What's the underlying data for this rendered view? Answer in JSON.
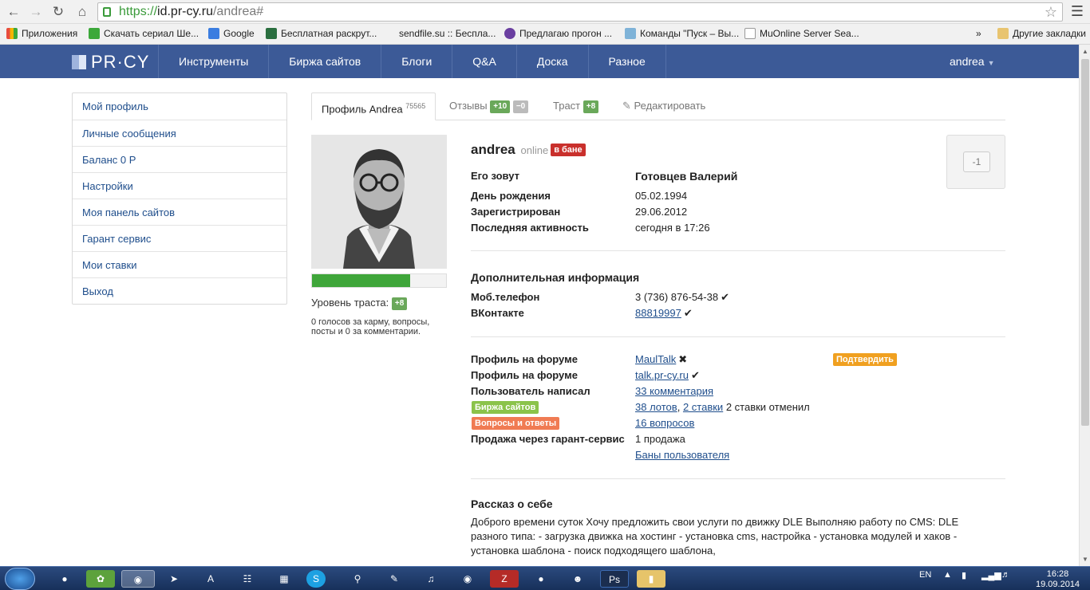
{
  "browser": {
    "url_scheme": "https://",
    "url_domain": "id.pr-cy.ru",
    "url_path": "/andrea#"
  },
  "bookmarks": {
    "items": [
      {
        "label": "Приложения",
        "color": "#e84c3d"
      },
      {
        "label": "Скачать сериал Ше...",
        "color": "#3ca83a"
      },
      {
        "label": "Google",
        "color": "#3b7de0"
      },
      {
        "label": "Бесплатная раскрут...",
        "color": "#2a6e3f"
      },
      {
        "label": "sendfile.su :: Беспла...",
        "color": "#ffffff"
      },
      {
        "label": "Предлагаю прогон ...",
        "color": "#6a3fa0"
      },
      {
        "label": "Команды \"Пуск – Вы...",
        "color": "#7fb3d8"
      },
      {
        "label": "MuOnline Server Sea...",
        "color": "#e6e6e6"
      }
    ],
    "more": "»",
    "other": "Другие закладки"
  },
  "site": {
    "logo": "PR·CY",
    "nav": [
      "Инструменты",
      "Биржа сайтов",
      "Блоги",
      "Q&A",
      "Доска",
      "Разное"
    ],
    "user": "andrea",
    "accent": "#3c5a97"
  },
  "sidebar": {
    "items": [
      "Мой профиль",
      "Личные сообщения",
      "Баланс 0 Р",
      "Настройки",
      "Моя панель сайтов",
      "Гарант сервис",
      "Мои ставки",
      "Выход"
    ]
  },
  "tabs": {
    "profile_label": "Профиль Andrea",
    "profile_count": "75565",
    "reviews_label": "Отзывы",
    "reviews_plus": "+10",
    "reviews_minus": "−0",
    "trust_label": "Траст",
    "trust_value": "+8",
    "edit_label": "Редактировать"
  },
  "trust": {
    "progress": 0.73,
    "level_label": "Уровень траста:",
    "level_value": "+8",
    "votes_text": "0 голосов за карму, вопросы, посты и 0 за комментарии."
  },
  "profile": {
    "username": "andrea",
    "status": "online",
    "ban_badge": "в бане",
    "vote_value": "-1",
    "fields": [
      {
        "label": "Его зовут",
        "value": "Готовцев Валерий"
      },
      {
        "label": "День рождения",
        "value": "05.02.1994"
      },
      {
        "label": "Зарегистрирован",
        "value": "29.06.2012"
      },
      {
        "label": "Последняя активность",
        "value": "сегодня в 17:26"
      }
    ]
  },
  "additional": {
    "title": "Дополнительная информация",
    "phone_label": "Моб.телефон",
    "phone_value": "3 (736) 876-54-38",
    "vk_label": "ВКонтакте",
    "vk_value": "88819997"
  },
  "activity": {
    "forum1_label": "Профиль на форуме",
    "forum1_value": "MaulTalk",
    "confirm_label": "Подтвердить",
    "forum2_label": "Профиль на форуме",
    "forum2_value": "talk.pr-cy.ru",
    "wrote_label": "Пользователь написал",
    "wrote_value": "33 комментария",
    "exchange_badge": "Биржа сайтов",
    "lots": "38 лотов",
    "sep": ",",
    "bids": "2 ставки",
    "bids_canceled": "2 ставки отменил",
    "qa_badge": "Вопросы и ответы",
    "questions": "16 вопросов",
    "guarantee_label": "Продажа через гарант-сервис",
    "guarantee_value": "1 продажа",
    "bans_link": "Баны пользователя"
  },
  "about": {
    "title": "Рассказ о себе",
    "text": "Доброго времени суток Хочу предложить свои услуги по движку DLE Выполняю работу по CMS: DLE разного типа: - загрузка движка на хостинг - установка cms, настройка - установка модулей и хаков - установка шаблона - поиск подходящего шаблона,"
  },
  "taskbar": {
    "lang": "EN",
    "time": "16:28",
    "date": "19.09.2014"
  }
}
